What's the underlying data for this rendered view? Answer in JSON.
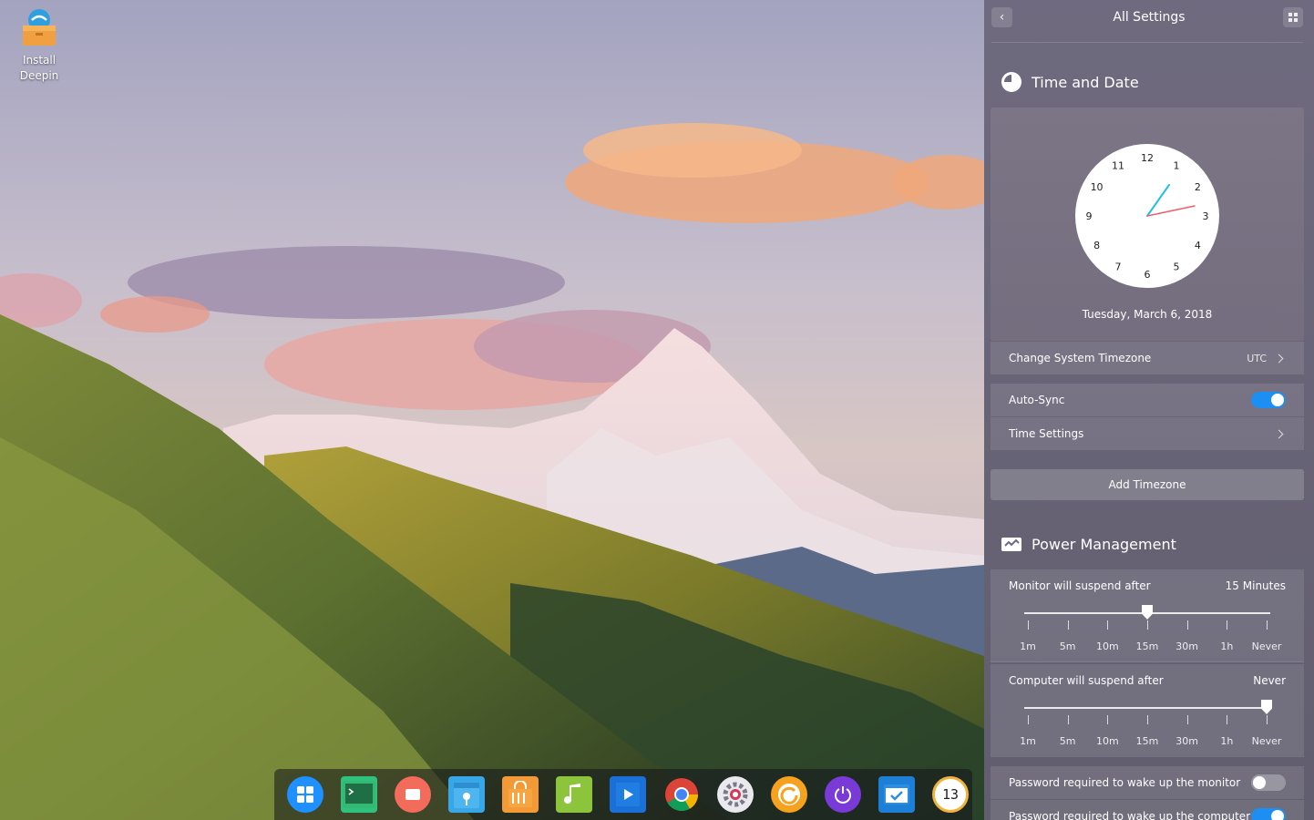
{
  "desktop": {
    "icon_label_line1": "Install",
    "icon_label_line2": "Deepin"
  },
  "dock": {
    "apps": [
      "launcher-icon",
      "terminal-icon",
      "screen-recorder-icon",
      "file-manager-icon",
      "app-store-icon",
      "music-icon",
      "video-player-icon",
      "chrome-icon",
      "control-center-icon",
      "deepin-id-icon",
      "power-icon",
      "system-monitor-icon",
      "clock-icon"
    ],
    "clock_text": "13"
  },
  "panel": {
    "title": "All Settings",
    "time_date": {
      "heading": "Time and Date",
      "clock_numbers": [
        "12",
        "1",
        "2",
        "3",
        "4",
        "5",
        "6",
        "7",
        "8",
        "9",
        "10",
        "11"
      ],
      "date": "Tuesday, March 6, 2018",
      "timezone_label": "Change System Timezone",
      "timezone_value": "UTC",
      "autosync_label": "Auto-Sync",
      "autosync_on": true,
      "time_settings_label": "Time Settings",
      "add_timezone": "Add Timezone"
    },
    "power": {
      "heading": "Power Management",
      "monitor_label": "Monitor will suspend after",
      "monitor_value": "15 Minutes",
      "monitor_level": 0.5,
      "computer_label": "Computer will suspend after",
      "computer_value": "Never",
      "computer_level": 1.0,
      "tick_labels": [
        "1m",
        "5m",
        "10m",
        "15m",
        "30m",
        "1h",
        "Never"
      ],
      "pw_monitor_label": "Password required to wake up the monitor",
      "pw_monitor_on": false,
      "pw_computer_label": "Password required to wake up the computer",
      "pw_computer_on": true
    }
  },
  "colors": {
    "accent": "#1d8ef2",
    "hour_hand": "#1ec0e8",
    "minute_hand": "#ee5f6e"
  }
}
